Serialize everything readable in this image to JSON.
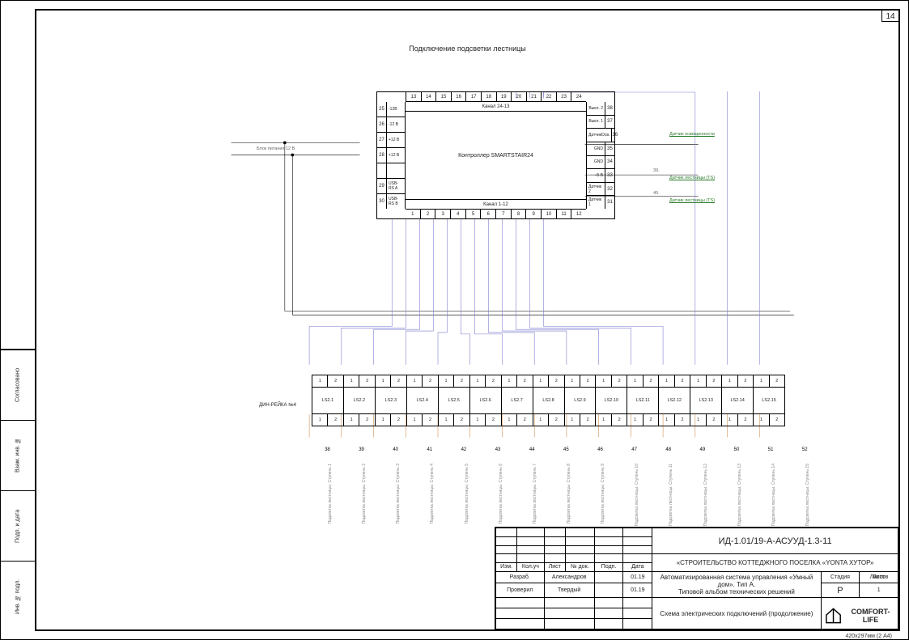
{
  "page_number": "14",
  "drawing_title": "Подключение подсветки лестницы",
  "power_source_label": "Блок питания 12 В",
  "controller": {
    "name": "Контроллер SMARTSTAIR24",
    "top_pins": [
      "24",
      "23",
      "22",
      "21",
      "20",
      "19",
      "18",
      "17",
      "16",
      "15",
      "14",
      "13"
    ],
    "bot_pins": [
      "1",
      "2",
      "3",
      "4",
      "5",
      "6",
      "7",
      "8",
      "9",
      "10",
      "11",
      "12"
    ],
    "ch_top": "Канал 24-13",
    "ch_bot": "Канал 1-12",
    "left": [
      {
        "n": "25",
        "l": "-12В"
      },
      {
        "n": "26",
        "l": "-12 В"
      },
      {
        "n": "27",
        "l": "+12 В"
      },
      {
        "n": "28",
        "l": "+12 В"
      },
      {
        "n": "",
        "l": ""
      },
      {
        "n": "29",
        "l": "USB-RS A"
      },
      {
        "n": "30",
        "l": "USB-RS B"
      }
    ],
    "right": [
      {
        "n": "38",
        "l": "Выкл. 2"
      },
      {
        "n": "37",
        "l": "Выкл. 1"
      },
      {
        "n": "36",
        "l": "ДатчикОсв."
      },
      {
        "n": "35",
        "l": "GND"
      },
      {
        "n": "34",
        "l": "GND"
      },
      {
        "n": "33",
        "l": "+5 В"
      },
      {
        "n": "32",
        "l": "Датчик 2"
      },
      {
        "n": "31",
        "l": "Датчик 1"
      }
    ]
  },
  "sensor_labels": {
    "light": "Датчик освещенности",
    "stair2": "Датчик лестницы (TS)",
    "stair1": "Датчик лестницы (TS)"
  },
  "sensor_nums": {
    "a": "39.",
    "b": "40."
  },
  "din_rail_label": "ДИН-РЕЙКА №4",
  "rail_modules": [
    "LS2.1",
    "LS2.2",
    "LS2.3",
    "LS2.4",
    "LS2.5",
    "LS2.6",
    "LS2.7",
    "LS2.8",
    "LS2.9",
    "LS2.10",
    "LS2.11",
    "LS2.12",
    "LS2.13",
    "LS2.14",
    "LS2.15"
  ],
  "cable_numbers": [
    "38",
    "39",
    "40",
    "41",
    "42",
    "43",
    "44",
    "45",
    "46",
    "47",
    "48",
    "49",
    "50",
    "51",
    "52"
  ],
  "vertical_labels": [
    "Подсветка лестницы. Ступень 1",
    "Подсветка лестницы. Ступень 2",
    "Подсветка лестницы. Ступень 3",
    "Подсветка лестницы. Ступень 4",
    "Подсветка лестницы. Ступень 5",
    "Подсветка лестницы. Ступень 6",
    "Подсветка лестницы. Ступень 7",
    "Подсветка лестницы. Ступень 8",
    "Подсветка лестницы. Ступень 9",
    "Подсветка лестницы. Ступень 10",
    "Подсветка лестницы. Ступень 11",
    "Подсветка лестницы. Ступень 12",
    "Подсветка лестницы. Ступень 13",
    "Подсветка лестницы. Ступень 14",
    "Подсветка лестницы. Ступень 15"
  ],
  "side_stamps": [
    "Согласовано",
    "Взам. инв. №",
    "Подп. и дата",
    "Инв. № подл."
  ],
  "title_block": {
    "drawing_code": "ИД-1.01/19-А-АСУУД-1.3-11",
    "project": "«СТРОИТЕЛЬСТВО КОТТЕДЖНОГО ПОСЕЛКА «YONTA ХУТОР»",
    "system1": "Автоматизированная система управления «Умный дом». Тип А.",
    "system2": "Типовой альбом технических решений",
    "sheet_title": "Схема электрических подключений (продолжение)",
    "rev_header": [
      "Изм.",
      "Кол.уч",
      "Лист",
      "№ док.",
      "Подп.",
      "Дата"
    ],
    "rows": [
      {
        "role": "Разраб.",
        "name": "Александров",
        "sign": "",
        "date": "01.19"
      },
      {
        "role": "Проверил",
        "name": "Твердый",
        "sign": "",
        "date": "01.19"
      }
    ],
    "stamp_labels": {
      "stage": "Стадия",
      "sheet": "Лист",
      "sheets": "Листов"
    },
    "stamp_values": {
      "stage": "Р",
      "sheet": "",
      "sheets": "1"
    },
    "company": "COMFORT-LIFE"
  },
  "paper_note": "420х297мм (2 А4)"
}
